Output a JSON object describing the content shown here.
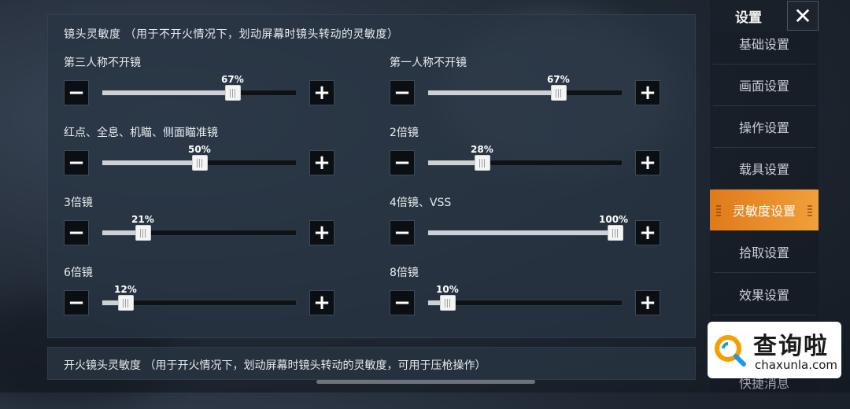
{
  "main": {
    "section_title": "镜头灵敏度 （用于不开火情况下，划动屏幕时镜头转动的灵敏度）",
    "groups": [
      {
        "label": "第三人称不开镜",
        "value": 67,
        "value_text": "67%"
      },
      {
        "label": "第一人称不开镜",
        "value": 67,
        "value_text": "67%"
      },
      {
        "label": "红点、全息、机瞄、侧面瞄准镜",
        "value": 50,
        "value_text": "50%"
      },
      {
        "label": "2倍镜",
        "value": 28,
        "value_text": "28%"
      },
      {
        "label": "3倍镜",
        "value": 21,
        "value_text": "21%"
      },
      {
        "label": "4倍镜、VSS",
        "value": 100,
        "value_text": "100%"
      },
      {
        "label": "6倍镜",
        "value": 12,
        "value_text": "12%"
      },
      {
        "label": "8倍镜",
        "value": 10,
        "value_text": "10%"
      }
    ],
    "minus_icon": "minus-icon",
    "plus_icon": "plus-icon"
  },
  "bottom": {
    "title": "开火镜头灵敏度 （用于开火情况下，划动屏幕时镜头转动的灵敏度，可用于压枪操作）"
  },
  "sidebar": {
    "title": "设置",
    "close_icon": "close-icon",
    "items": [
      {
        "label": "基础设置",
        "active": false
      },
      {
        "label": "画面设置",
        "active": false
      },
      {
        "label": "操作设置",
        "active": false
      },
      {
        "label": "载具设置",
        "active": false
      },
      {
        "label": "灵敏度设置",
        "active": true
      },
      {
        "label": "拾取设置",
        "active": false
      },
      {
        "label": "效果设置",
        "active": false
      }
    ],
    "partial_item": "快捷消息"
  },
  "watermark": {
    "text": "查询啦",
    "url": "chaxunla.com"
  },
  "colors": {
    "accent": "#f0a03a",
    "panel": "#283442",
    "slider_fill": "#cdd1d5"
  }
}
